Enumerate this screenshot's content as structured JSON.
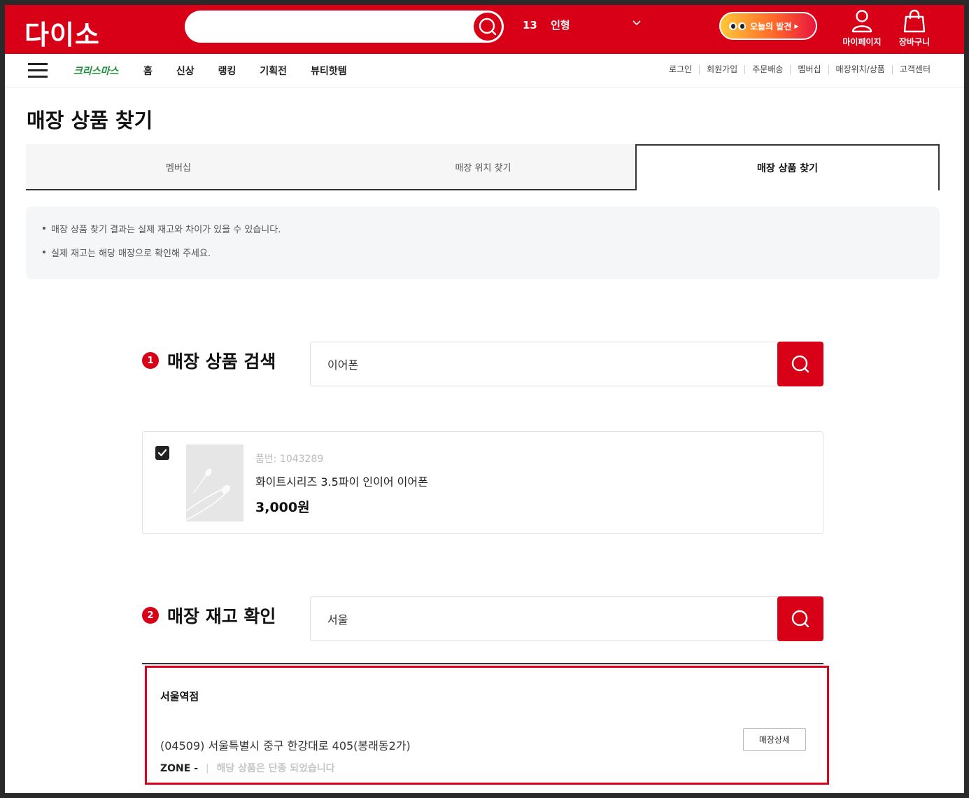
{
  "header": {
    "logo": "다이소",
    "search": {
      "value": "",
      "placeholder": ""
    },
    "rank": {
      "number": "13",
      "keyword": "인형"
    },
    "today_button": "오늘의 발견",
    "mypage_label": "마이페이지",
    "cart_label": "장바구니",
    "brand_color": "#d80016"
  },
  "nav": {
    "xmas_label": "크리스마스",
    "links": [
      "홈",
      "신상",
      "랭킹",
      "기획전",
      "뷰티핫템"
    ],
    "utils": [
      "로그인",
      "회원가입",
      "주문배송",
      "멤버십",
      "매장위치/상품",
      "고객센터"
    ]
  },
  "page": {
    "title": "매장 상품 찾기",
    "tabs": [
      "멤버십",
      "매장 위치 찾기",
      "매장 상품 찾기"
    ],
    "active_tab": 2,
    "notices": [
      "매장 상품 찾기 결과는 실제 재고와 차이가 있을 수 있습니다.",
      "실제 재고는 해당 매장으로 확인해 주세요."
    ]
  },
  "step1": {
    "number": "1",
    "label": "매장 상품 검색",
    "value": "이어폰"
  },
  "product": {
    "checked": true,
    "code": "품번: 1043289",
    "name": "화이트시리즈 3.5파이 인이어 이어폰",
    "price": "3,000원"
  },
  "step2": {
    "number": "2",
    "label": "매장 재고 확인",
    "value": "서울"
  },
  "store": {
    "name": "서울역점",
    "address": "(04509) 서울특별시 중구 한강대로 405(봉래동2가)",
    "zone": "ZONE -",
    "separator": "|",
    "message": "해당 상품은 단종 되었습니다",
    "detail_button": "매장상세",
    "highlight_color": "#e0001a"
  }
}
